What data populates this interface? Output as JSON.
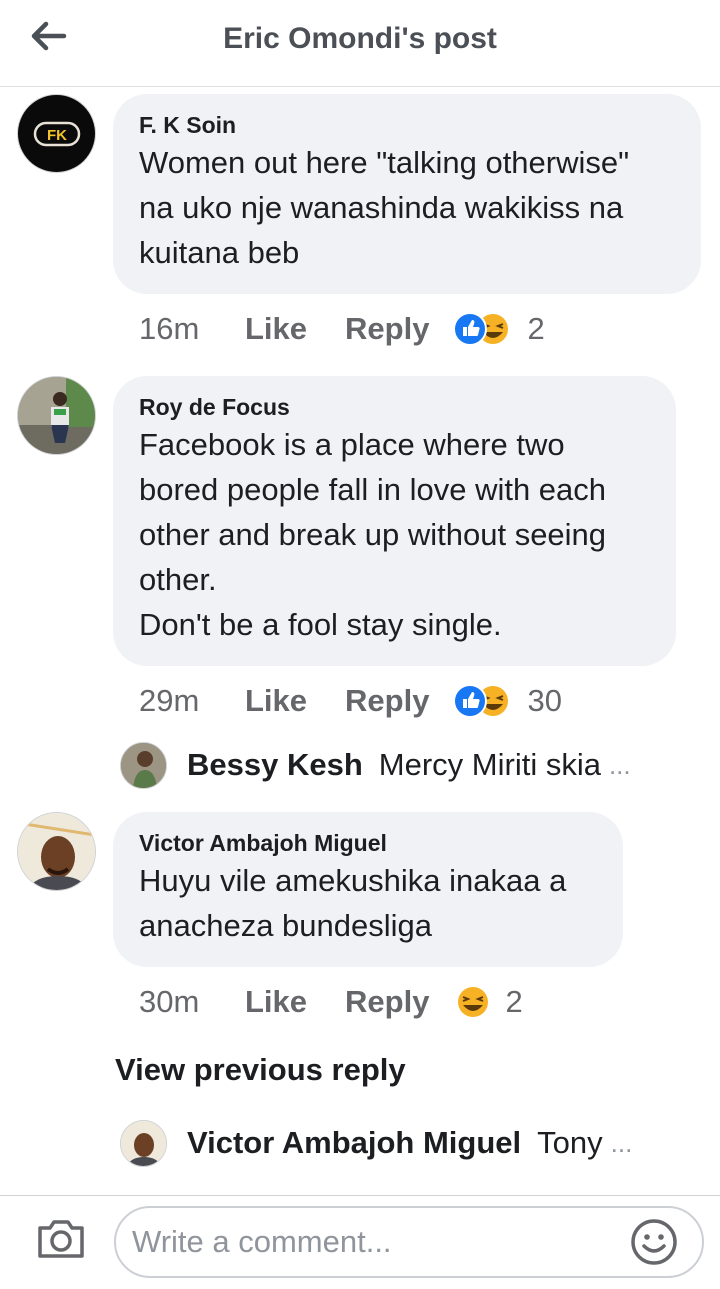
{
  "header": {
    "title": "Eric Omondi's post"
  },
  "comments": [
    {
      "author": "F. K Soin",
      "avatar_text": "FK",
      "text": "Women out here \"talking otherwise\"\nna uko nje wanashinda wakikiss na\nkuitana beb",
      "time": "16m",
      "like": "Like",
      "reply": "Reply",
      "reaction_count": "2",
      "reactions": [
        "like-icon",
        "haha-icon"
      ]
    },
    {
      "author": "Roy de Focus",
      "text": "Facebook is a place where two\nbored people fall in love with each\nother and break up without seeing\nother.\nDon't be a fool stay single.",
      "time": "29m",
      "like": "Like",
      "reply": "Reply",
      "reaction_count": "30",
      "reactions": [
        "like-icon",
        "haha-icon"
      ],
      "reply_preview": {
        "name": "Bessy Kesh",
        "text": "Mercy Miriti  skia",
        "ellipsis": "..."
      }
    },
    {
      "author": "Victor Ambajoh Miguel",
      "text": "Huyu vile amekushika inakaa a\nanacheza bundesliga",
      "time": "30m",
      "like": "Like",
      "reply": "Reply",
      "reaction_count": "2",
      "reactions": [
        "haha-icon"
      ],
      "view_previous": "View previous reply",
      "reply_preview": {
        "name": "Victor Ambajoh Miguel",
        "text": "Tony",
        "ellipsis": "..."
      }
    }
  ],
  "composer": {
    "placeholder": "Write a comment..."
  },
  "icons": {
    "back": "back-arrow-icon",
    "camera": "camera-icon",
    "emoji": "smiley-icon"
  },
  "colors": {
    "like_blue": "#1877f2",
    "haha_yellow": "#f7b125",
    "bubble": "#f0f2f5",
    "meta_gray": "#65676b"
  }
}
